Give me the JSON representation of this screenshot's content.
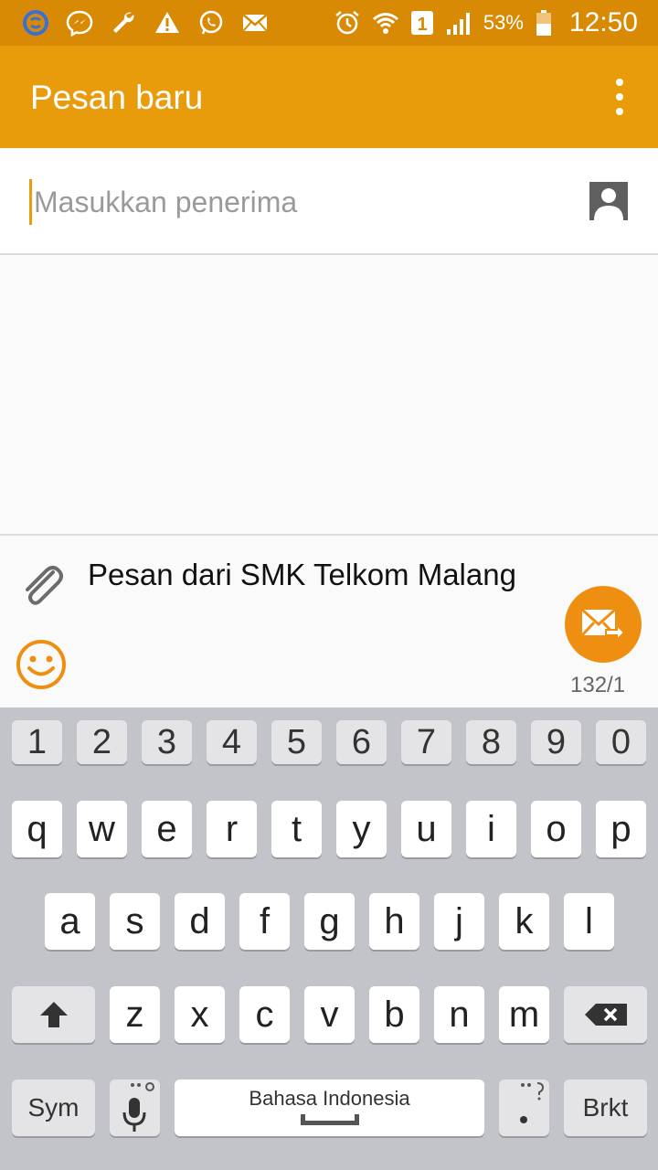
{
  "status_bar": {
    "battery_percent": "53%",
    "time": "12:50",
    "sim_slot": "1",
    "icons": [
      "s-icon",
      "messenger-icon",
      "wrench-icon",
      "warning-icon",
      "whatsapp-icon",
      "email-icon",
      "alarm-icon",
      "wifi-icon",
      "sim-icon",
      "signal-icon",
      "battery-icon"
    ]
  },
  "app_bar": {
    "title": "Pesan baru",
    "menu_icon": "more-vert-icon"
  },
  "recipient": {
    "placeholder": "Masukkan penerima",
    "contact_icon": "contact-icon"
  },
  "compose": {
    "message": "Pesan dari SMK Telkom Malang",
    "counter": "132/1",
    "attach_icon": "paperclip-icon",
    "emoji_icon": "emoji-icon",
    "send_icon": "send-icon"
  },
  "keyboard": {
    "numbers": [
      "1",
      "2",
      "3",
      "4",
      "5",
      "6",
      "7",
      "8",
      "9",
      "0"
    ],
    "row1": [
      "q",
      "w",
      "e",
      "r",
      "t",
      "y",
      "u",
      "i",
      "o",
      "p"
    ],
    "row2": [
      "a",
      "s",
      "d",
      "f",
      "g",
      "h",
      "j",
      "k",
      "l"
    ],
    "row3": [
      "z",
      "x",
      "c",
      "v",
      "b",
      "n",
      "m"
    ],
    "sym_label": "Sym",
    "space_label": "Bahasa Indonesia",
    "enter_label": "Brkt",
    "shift_icon": "shift-icon",
    "backspace_icon": "backspace-icon",
    "mic_icon": "mic-icon"
  },
  "colors": {
    "status_bar": "#d98a05",
    "app_bar": "#e99c0b",
    "send_button": "#ef8f12",
    "keyboard_bg": "#c3c4c9"
  }
}
